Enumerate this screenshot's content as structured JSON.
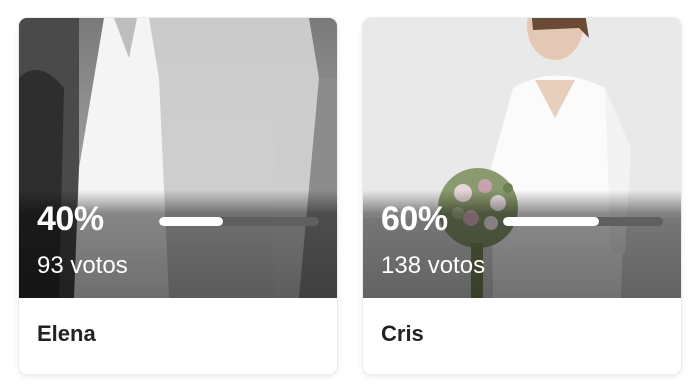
{
  "poll": {
    "options": [
      {
        "percent_label": "40%",
        "percent": 40,
        "votes_label": "93 votos",
        "name": "Elena"
      },
      {
        "percent_label": "60%",
        "percent": 60,
        "votes_label": "138 votos",
        "name": "Cris"
      }
    ]
  },
  "colors": {
    "bar_track": "#5f5f5f",
    "bar_fill": "#ffffff",
    "name_text": "#222222"
  }
}
